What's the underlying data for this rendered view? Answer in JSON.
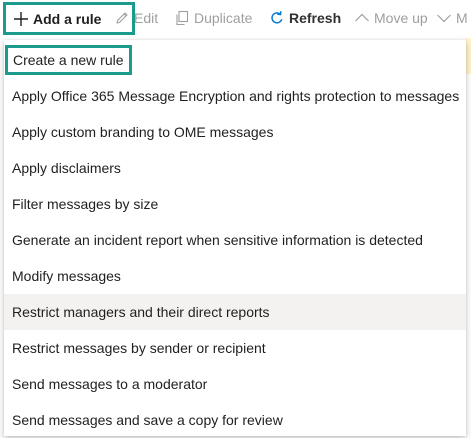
{
  "toolbar": {
    "add_rule": "Add a rule",
    "edit": "Edit",
    "duplicate": "Duplicate",
    "refresh": "Refresh",
    "move_up": "Move up"
  },
  "menu": {
    "items": [
      "Create a new rule",
      "Apply Office 365 Message Encryption and rights protection to messages",
      "Apply custom branding to OME messages",
      "Apply disclaimers",
      "Filter messages by size",
      "Generate an incident report when sensitive information is detected",
      "Modify messages",
      "Restrict managers and their direct reports",
      "Restrict messages by sender or recipient",
      "Send messages to a moderator",
      "Send messages and save a copy for review"
    ]
  },
  "colors": {
    "highlight_border": "#1c9a8b",
    "hover_background": "#f3f2f1",
    "refresh_icon": "#0078d4",
    "disabled_text": "#a19f9d"
  }
}
